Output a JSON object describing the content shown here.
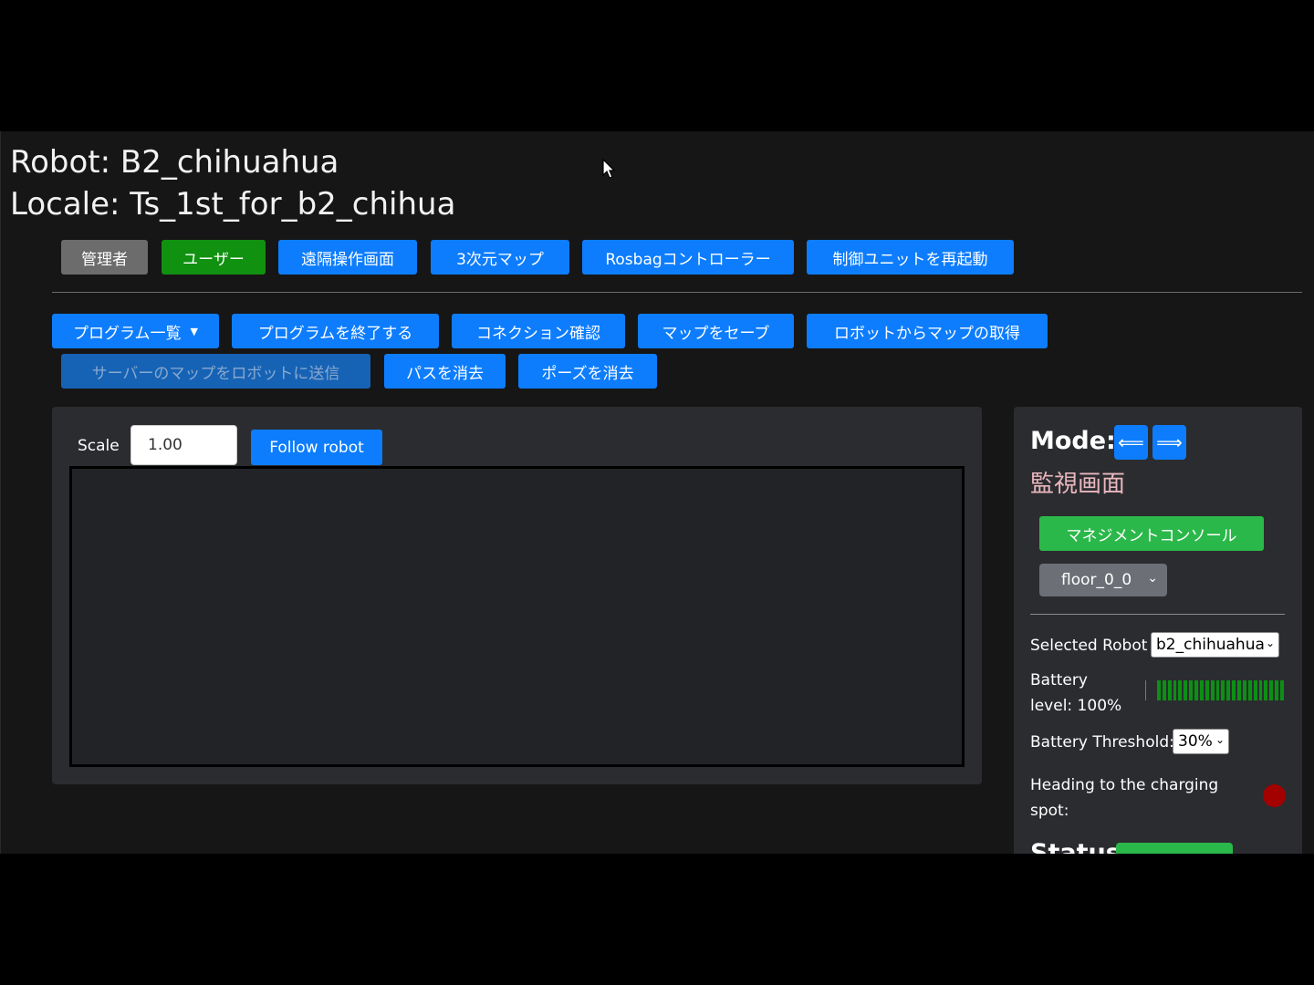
{
  "header": {
    "robot_line": "Robot: B2_chihuahua",
    "locale_line": "Locale: Ts_1st_for_b2_chihua"
  },
  "top_buttons": {
    "admin": "管理者",
    "user": "ユーザー",
    "remote": "遠隔操作画面",
    "map3d": "3次元マップ",
    "rosbag": "Rosbagコントローラー",
    "restart": "制御ユニットを再起動"
  },
  "action_buttons": {
    "program_list": "プログラム一覧",
    "program_end": "プログラムを終了する",
    "connection": "コネクション確認",
    "save_map": "マップをセーブ",
    "get_map": "ロボットからマップの取得",
    "send_map": "サーバーのマップをロボットに送信",
    "clear_path": "パスを消去",
    "clear_pose": "ポーズを消去"
  },
  "map_panel": {
    "scale_label": "Scale",
    "scale_value": "1.00",
    "follow_button": "Follow robot"
  },
  "side_panel": {
    "mode_label": "Mode:",
    "mode_prev": "⟸",
    "mode_next": "⟹",
    "mode_name": "監視画面",
    "management_button": "マネジメントコンソール",
    "floor_select": "floor_0_0",
    "selected_robot_label": "Selected Robot",
    "selected_robot_value": "b2_chihuahua",
    "battery_label_1": "Battery",
    "battery_label_2": "level: 100%",
    "battery_level": 1.0,
    "battery_threshold_label": "Battery Threshold:",
    "battery_threshold_value": "30%",
    "charging_label_1": "Heading to the charging",
    "charging_label_2": "spot:",
    "charging_indicator_color": "#a30000",
    "status_label": "Status:"
  },
  "colors": {
    "primary": "#0d7dfd",
    "success": "#2bb84a",
    "battery": "#0c8f14"
  }
}
